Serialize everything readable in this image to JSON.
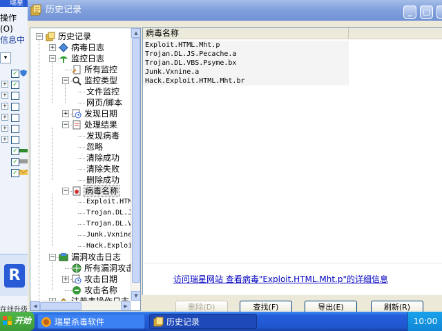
{
  "background_app": {
    "title": "瑞星",
    "menu": "操作(O)",
    "info_tab": "信息中",
    "bottom_label": "在线升级"
  },
  "window": {
    "title": "历史记录"
  },
  "tree": {
    "nodes": [
      {
        "label": "历史记录",
        "expander": "−",
        "icon": "history-icon"
      },
      {
        "label": "病毒日志",
        "expander": "+",
        "icon": "virus-log-icon"
      },
      {
        "label": "监控日志",
        "expander": "−",
        "icon": "monitor-log-icon"
      },
      {
        "label": "所有监控",
        "icon": "document-icon"
      },
      {
        "label": "监控类型",
        "expander": "−",
        "icon": "search-icon"
      },
      {
        "label": "文件监控"
      },
      {
        "label": "网页/脚本"
      },
      {
        "label": "发现日期",
        "expander": "+",
        "icon": "clock-icon"
      },
      {
        "label": "处理结果",
        "expander": "−",
        "icon": "result-icon"
      },
      {
        "label": "发现病毒"
      },
      {
        "label": "忽略"
      },
      {
        "label": "清除成功"
      },
      {
        "label": "清除失败"
      },
      {
        "label": "删除成功"
      },
      {
        "label": "病毒名称",
        "expander": "−",
        "icon": "virus-name-icon"
      },
      {
        "label": "Exploit.HTML.Mht.p"
      },
      {
        "label": "Trojan.DL.JS.Pecache.a"
      },
      {
        "label": "Trojan.DL.VBS.Psyme.bx"
      },
      {
        "label": "Junk.Vxnine.a"
      },
      {
        "label": "Hack.Exploit.HTML.Mht.br"
      },
      {
        "label": "漏洞攻击日志",
        "expander": "−",
        "icon": "exploit-log-icon"
      },
      {
        "label": "所有漏洞攻击",
        "icon": "globe-icon"
      },
      {
        "label": "攻击日期",
        "expander": "+",
        "icon": "clock-icon"
      },
      {
        "label": "攻击名称",
        "icon": "attack-icon"
      },
      {
        "label": "注册表操作日志",
        "expander": "+",
        "icon": "registry-icon"
      }
    ]
  },
  "list": {
    "column_header": "病毒名称",
    "rows": [
      "Exploit.HTML.Mht.p",
      "Trojan.DL.JS.Pecache.a",
      "Trojan.DL.VBS.Psyme.bx",
      "Junk.Vxnine.a",
      "Hack.Exploit.HTML.Mht.br"
    ]
  },
  "link": {
    "text": "访问瑞星网站 查看病毒\"Exploit.HTML.Mht.p\"的详细信息"
  },
  "buttons": {
    "delete": "删除(D)",
    "find": "查找(F)",
    "export": "导出(E)",
    "refresh": "刷新(R)"
  },
  "taskbar": {
    "start": "开始",
    "task1": "瑞星杀毒软件",
    "task2": "历史记录",
    "clock": "10:00"
  }
}
